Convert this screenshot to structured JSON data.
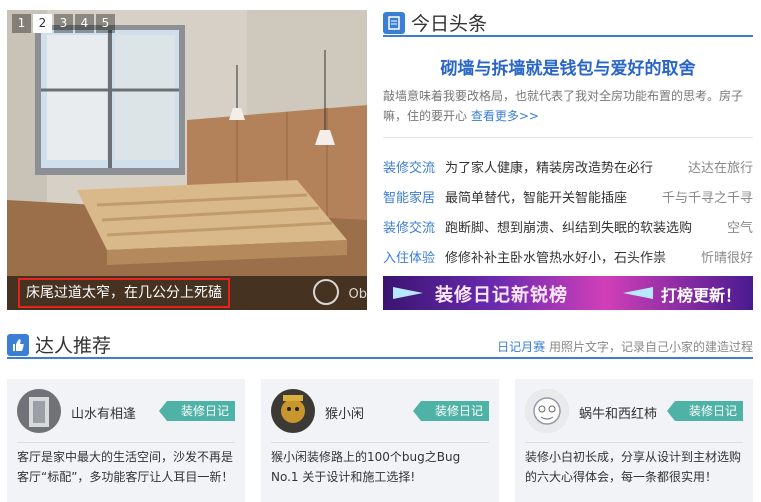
{
  "carousel": {
    "pages": [
      "1",
      "2",
      "3",
      "4",
      "5"
    ],
    "active_index": 1,
    "caption": "床尾过道太窄，在几公分上死磕",
    "watermark": "Ob"
  },
  "today": {
    "title": "今日头条",
    "headline": "砌墙与拆墙就是钱包与爱好的取舍",
    "summary": "敲墙意味着我要改格局，也就代表了我对全房功能布置的思考。房子嘛，住的要开心",
    "more": "查看更多>>",
    "news": [
      {
        "category": "装修交流",
        "title": "为了家人健康，精装房改造势在必行",
        "author": "达达在旅行"
      },
      {
        "category": "智能家居",
        "title": "最简单替代，智能开关智能插座",
        "author": "千与千寻之千寻"
      },
      {
        "category": "装修交流",
        "title": "跑断脚、想到崩溃、纠结到失眠的软装选购",
        "author": "空气"
      },
      {
        "category": "入住体验",
        "title": "修修补补主卧水管热水好小，石头作祟",
        "author": "忻晴很好"
      }
    ]
  },
  "banner": {
    "main": "装修日记新锐榜",
    "cta": "打榜更新！"
  },
  "experts": {
    "title": "达人推荐",
    "right_link": "日记月赛",
    "right_text": "用照片文字，记录自己小家的建造过程",
    "cards": [
      {
        "name": "山水有相逢",
        "badge": "装修日记",
        "text": "客厅是家中最大的生活空间，沙发不再是客厅“标配”，多功能客厅让人耳目一新！"
      },
      {
        "name": "猴小闲",
        "badge": "装修日记",
        "text": "猴小闲装修路上的100个bug之Bug No.1 关于设计和施工选择!"
      },
      {
        "name": "蜗牛和西红柿",
        "badge": "装修日记",
        "text": "装修小白初长成，分享从设计到主材选购的六大心得体会，每一条都很实用！"
      }
    ]
  },
  "colors": {
    "accent": "#3a7ed6",
    "badge": "#4eb3a6",
    "caption_border": "#e8231f"
  }
}
